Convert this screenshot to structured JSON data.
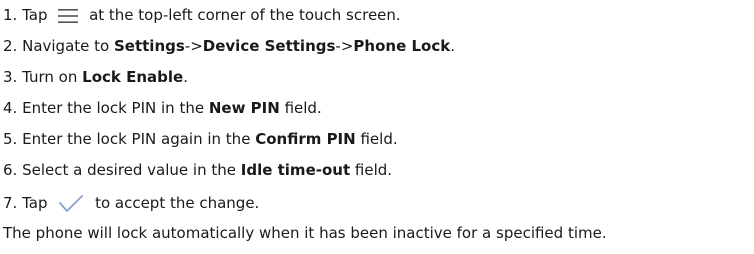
{
  "steps": [
    {
      "num": "1.",
      "pre": "Tap",
      "post": "at the top-left corner of the touch screen.",
      "icon": "menu-icon"
    },
    {
      "num": "2.",
      "pre": "Navigate to",
      "b1": "Settings",
      "sep1": "->",
      "b2": "Device Settings",
      "sep2": "->",
      "b3": "Phone Lock",
      "post": "."
    },
    {
      "num": "3.",
      "pre": "Turn on",
      "b1": "Lock Enable",
      "post": "."
    },
    {
      "num": "4.",
      "pre": "Enter the lock PIN in the",
      "b1": "New PIN",
      "post": "field."
    },
    {
      "num": "5.",
      "pre": "Enter the lock PIN again in the",
      "b1": "Confirm PIN",
      "post": "field."
    },
    {
      "num": "6.",
      "pre": "Select a desired value in the",
      "b1": "Idle time-out",
      "post": "field."
    },
    {
      "num": "7.",
      "pre": "Tap",
      "post": "to accept the change.",
      "icon": "checkmark-icon"
    }
  ],
  "note": "The phone will lock automatically when it has been inactive for a specified time.",
  "colors": {
    "menu_icon": "#555555",
    "check_icon": "#8a9fd8"
  }
}
